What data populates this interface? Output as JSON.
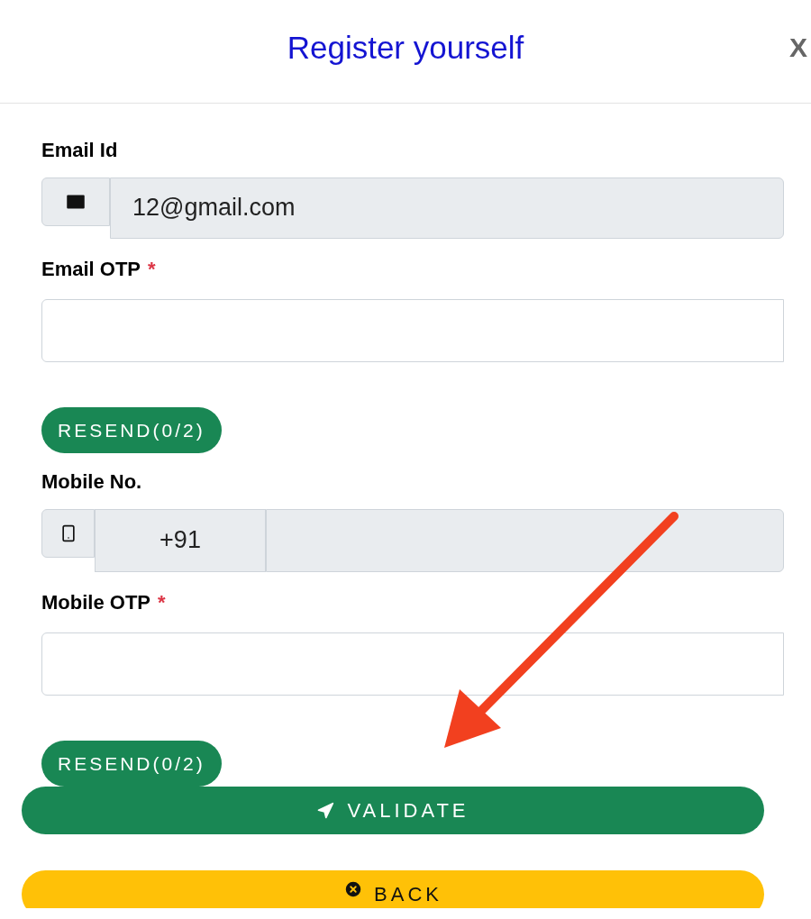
{
  "dialog": {
    "title": "Register yourself",
    "close_label": "X"
  },
  "fields": [
    {
      "kind": "email",
      "label": "Email Id",
      "value": "12@gmail.com"
    },
    {
      "kind": "otp",
      "label": "Email OTP",
      "mark": "*",
      "resend": "RESEND(0/2)"
    },
    {
      "kind": "phone",
      "label": "Mobile No.",
      "prefix": "+91"
    },
    {
      "kind": "otp",
      "label": "Mobile OTP",
      "mark": "*",
      "resend": "RESEND(0/2)"
    }
  ],
  "buttons": [
    {
      "kind": "validate",
      "label": "VALIDATE"
    },
    {
      "kind": "back",
      "label": "BACK"
    }
  ],
  "annotation": {
    "kind": "arrow"
  }
}
